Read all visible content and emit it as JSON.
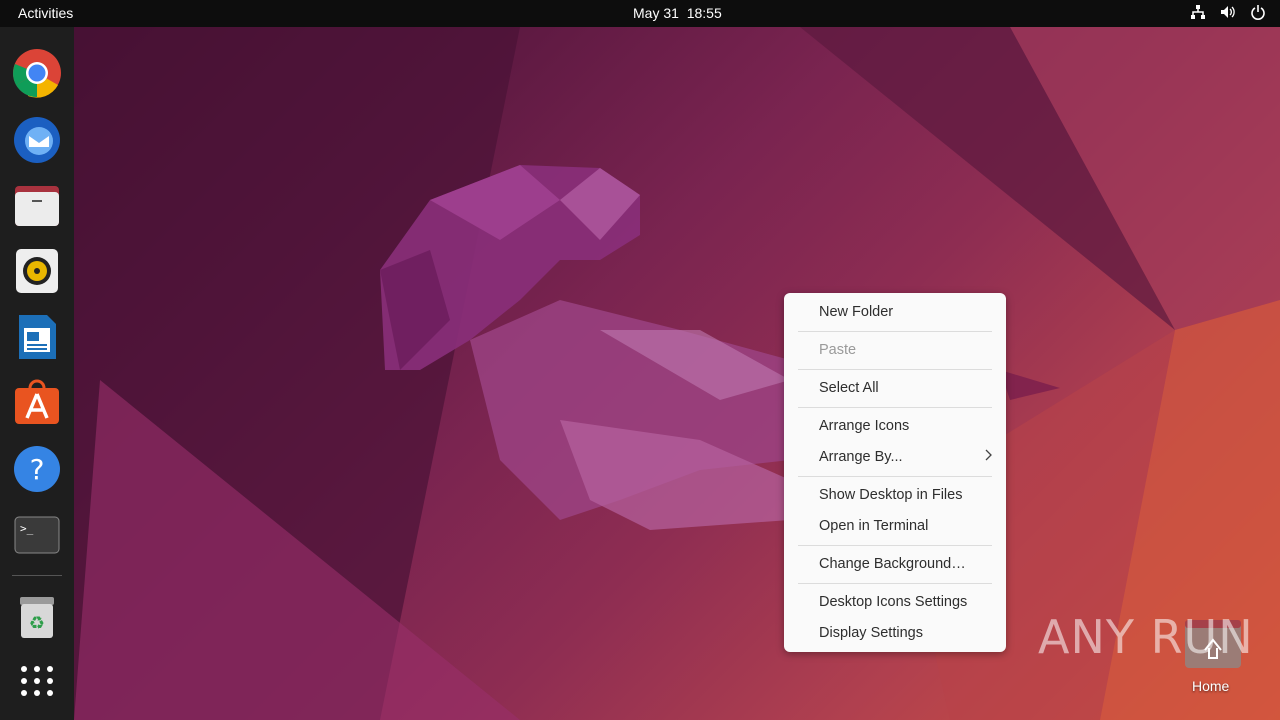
{
  "topbar": {
    "activities": "Activities",
    "clock": "May 31  18:55",
    "tray_icons": [
      "network-icon",
      "volume-icon",
      "power-icon"
    ]
  },
  "dock": {
    "items": [
      {
        "name": "chrome-icon"
      },
      {
        "name": "thunderbird-icon"
      },
      {
        "name": "files-icon"
      },
      {
        "name": "rhythmbox-icon"
      },
      {
        "name": "libreoffice-writer-icon"
      },
      {
        "name": "app-center-icon"
      },
      {
        "name": "help-icon"
      },
      {
        "name": "terminal-icon"
      },
      {
        "name": "trash-icon"
      },
      {
        "name": "show-apps-icon"
      }
    ]
  },
  "context_menu": {
    "new_folder": "New Folder",
    "paste": "Paste",
    "select_all": "Select All",
    "arrange_icons": "Arrange Icons",
    "arrange_by": "Arrange By...",
    "show_desktop_in_files": "Show Desktop in Files",
    "open_in_terminal": "Open in Terminal",
    "change_background": "Change Background…",
    "desktop_icons_settings": "Desktop Icons Settings",
    "display_settings": "Display Settings"
  },
  "desktop": {
    "home_label": "Home"
  },
  "watermark": "ANY RUN"
}
